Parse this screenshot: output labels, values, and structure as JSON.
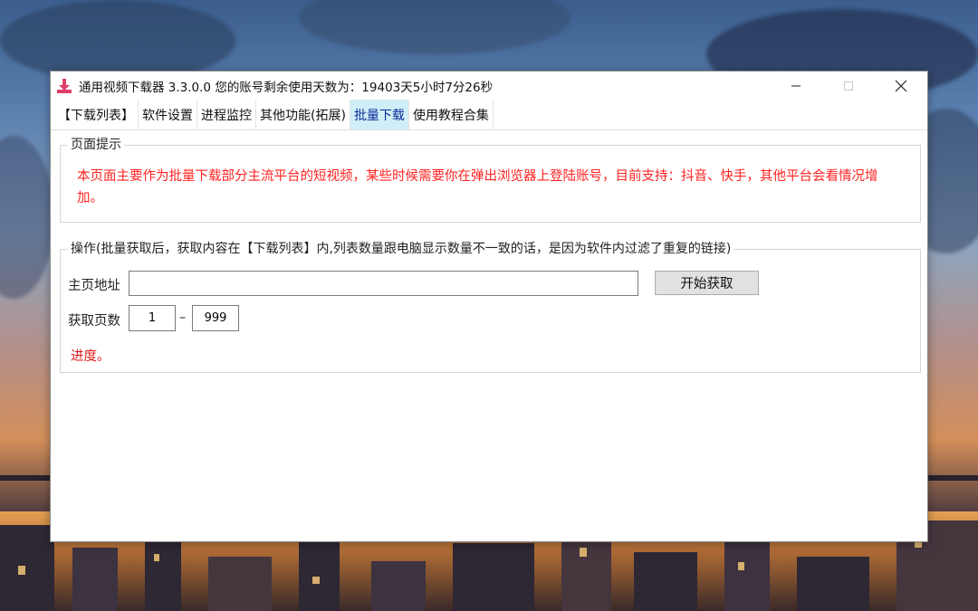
{
  "window": {
    "title": "通用视频下载器  3.3.0.0  您的账号剩余使用天数为：19403天5小时7分26秒",
    "icon": "download-icon",
    "controls": {
      "minimize": "—",
      "maximize": "☐",
      "close": "✕"
    }
  },
  "tabs": [
    {
      "label": "【下载列表】",
      "active": false
    },
    {
      "label": "软件设置",
      "active": false
    },
    {
      "label": "进程监控",
      "active": false
    },
    {
      "label": "其他功能(拓展)",
      "active": false
    },
    {
      "label": "批量下载",
      "active": true
    },
    {
      "label": "使用教程合集",
      "active": false
    }
  ],
  "hint_group": {
    "legend": "页面提示",
    "text": "本页面主要作为批量下载部分主流平台的短视频，某些时候需要你在弹出浏览器上登陆账号，目前支持：抖音、快手，其他平台会看情况增加。",
    "color": "#ff2222"
  },
  "operation_group": {
    "legend": "操作(批量获取后，获取内容在【下载列表】内,列表数量跟电脑显示数量不一致的话，是因为软件内过滤了重复的链接)",
    "homepage_label": "主页地址",
    "homepage_value": "",
    "fetch_button": "开始获取",
    "pages_label": "获取页数",
    "page_from": "1",
    "page_separator": "–",
    "page_to": "999",
    "progress": "进度。"
  },
  "colors": {
    "active_tab_bg": "#cfeef7",
    "active_tab_text": "#0a2a9a",
    "progress_text": "#e01b1b"
  }
}
